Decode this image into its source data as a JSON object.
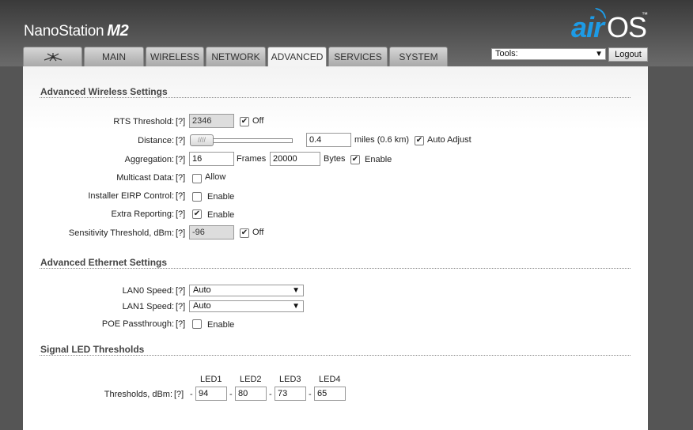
{
  "header": {
    "device_name": "NanoStation",
    "device_model": "M2",
    "brand_air": "air",
    "brand_os": "OS",
    "brand_tm": "™"
  },
  "tabs": [
    {
      "label": "",
      "icon": "ubiquiti-logo-icon"
    },
    {
      "label": "MAIN"
    },
    {
      "label": "WIRELESS"
    },
    {
      "label": "NETWORK"
    },
    {
      "label": "ADVANCED",
      "active": true
    },
    {
      "label": "SERVICES"
    },
    {
      "label": "SYSTEM"
    }
  ],
  "tools": {
    "value": "Tools:",
    "logout_label": "Logout"
  },
  "help": "[?]",
  "wireless": {
    "title": "Advanced Wireless Settings",
    "rts": {
      "label": "RTS Threshold:",
      "value": "2346",
      "check_label": "Off",
      "checked": true
    },
    "distance": {
      "label": "Distance:",
      "value": "0.4",
      "unit": "miles (0.6 km)",
      "check_label": "Auto Adjust",
      "checked": true
    },
    "aggregation": {
      "label": "Aggregation:",
      "frames": "16",
      "frames_label": "Frames",
      "bytes": "20000",
      "bytes_label": "Bytes",
      "check_label": "Enable",
      "checked": true
    },
    "multicast": {
      "label": "Multicast Data:",
      "check_label": "Allow",
      "checked": false
    },
    "eirp": {
      "label": "Installer EIRP Control:",
      "check_label": "Enable",
      "checked": false
    },
    "extra": {
      "label": "Extra Reporting:",
      "check_label": "Enable",
      "checked": true
    },
    "sensitivity": {
      "label": "Sensitivity Threshold, dBm:",
      "value": "-96",
      "check_label": "Off",
      "checked": true
    }
  },
  "ethernet": {
    "title": "Advanced Ethernet Settings",
    "lan0": {
      "label": "LAN0 Speed:",
      "value": "Auto"
    },
    "lan1": {
      "label": "LAN1 Speed:",
      "value": "Auto"
    },
    "poe": {
      "label": "POE Passthrough:",
      "check_label": "Enable",
      "checked": false
    }
  },
  "led": {
    "title": "Signal LED Thresholds",
    "headers": [
      "LED1",
      "LED2",
      "LED3",
      "LED4"
    ],
    "label": "Thresholds, dBm:",
    "sep": "-",
    "values": [
      "94",
      "80",
      "73",
      "65"
    ]
  }
}
